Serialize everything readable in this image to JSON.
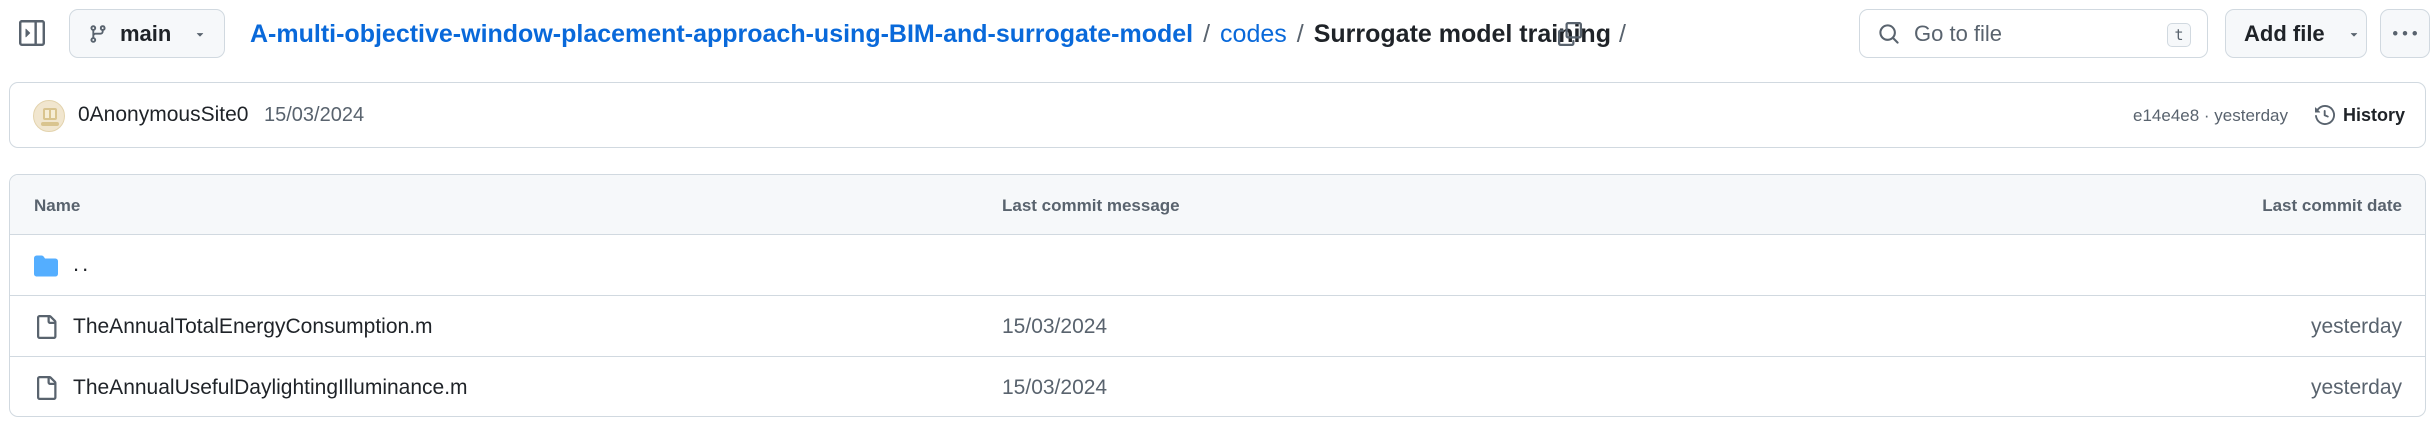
{
  "header": {
    "branch": "main",
    "breadcrumb": {
      "repo": "A-multi-objective-window-placement-approach-using-BIM-and-surrogate-model",
      "folder": "codes",
      "current": "Surrogate model training",
      "separator": "/"
    },
    "search": {
      "placeholder": "Go to file",
      "shortcut": "t"
    },
    "add_file_label": "Add file",
    "icons": [
      "sidebar-toggle-icon",
      "git-branch-icon",
      "chevron-down-icon",
      "copy-icon",
      "search-icon",
      "kebab-horizontal-icon"
    ]
  },
  "latest_commit": {
    "author": "0AnonymousSite0",
    "message": "15/03/2024",
    "hash_time": "e14e4e8 · yesterday",
    "history_label": "History"
  },
  "files": {
    "columns": {
      "name": "Name",
      "message": "Last commit message",
      "date": "Last commit date"
    },
    "parent_dir": "..",
    "rows": [
      {
        "name": "TheAnnualTotalEnergyConsumption.m",
        "message": "15/03/2024",
        "date": "yesterday",
        "icon": "file-icon"
      },
      {
        "name": "TheAnnualUsefulDaylightingIlluminance.m",
        "message": "15/03/2024",
        "date": "yesterday",
        "icon": "file-icon"
      }
    ]
  },
  "colors": {
    "link": "#0969da",
    "text": "#1f2328",
    "muted": "#59636e",
    "border": "#d1d9e0",
    "header_bg": "#f6f8fa",
    "folder": "#54aeff"
  }
}
